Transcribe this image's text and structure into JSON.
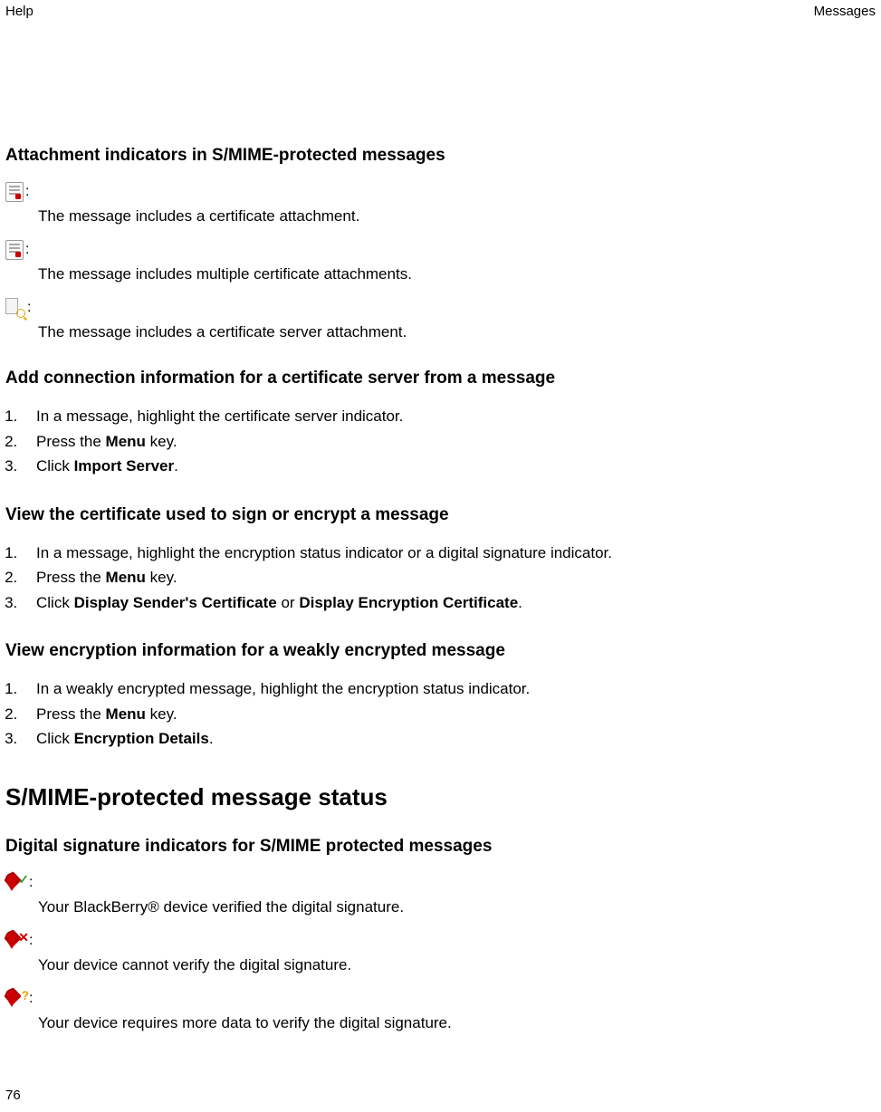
{
  "header": {
    "left": "Help",
    "right": "Messages"
  },
  "page_number": "76",
  "section1": {
    "title": "Attachment indicators in S/MIME-protected messages",
    "items": [
      {
        "desc": "The message includes a certificate attachment."
      },
      {
        "desc": "The message includes multiple certificate attachments."
      },
      {
        "desc": "The message includes a certificate server attachment."
      }
    ]
  },
  "section2": {
    "title": "Add connection information for a certificate server from a message",
    "steps": {
      "s1": "In a message, highlight the certificate server indicator.",
      "s2a": "Press the ",
      "s2b": "Menu",
      "s2c": " key.",
      "s3a": "Click ",
      "s3b": "Import Server",
      "s3c": "."
    }
  },
  "section3": {
    "title": "View the certificate used to sign or encrypt a message",
    "steps": {
      "s1": "In a message, highlight the encryption status indicator or a digital signature indicator.",
      "s2a": "Press the ",
      "s2b": "Menu",
      "s2c": " key.",
      "s3a": "Click ",
      "s3b": "Display Sender's Certificate",
      "s3c": " or ",
      "s3d": "Display Encryption Certificate",
      "s3e": "."
    }
  },
  "section4": {
    "title": "View encryption information for a weakly encrypted message",
    "steps": {
      "s1": "In a weakly encrypted message, highlight the encryption status indicator.",
      "s2a": "Press the ",
      "s2b": "Menu",
      "s2c": " key.",
      "s3a": "Click ",
      "s3b": "Encryption Details",
      "s3c": "."
    }
  },
  "main_title": "S/MIME-protected message status",
  "section5": {
    "title": "Digital signature indicators for S/MIME protected messages",
    "items": [
      {
        "desc": "Your BlackBerry® device verified the digital signature."
      },
      {
        "desc": "Your device cannot verify the digital signature."
      },
      {
        "desc": "Your device requires more data to verify the digital signature."
      }
    ]
  },
  "colon": ":"
}
